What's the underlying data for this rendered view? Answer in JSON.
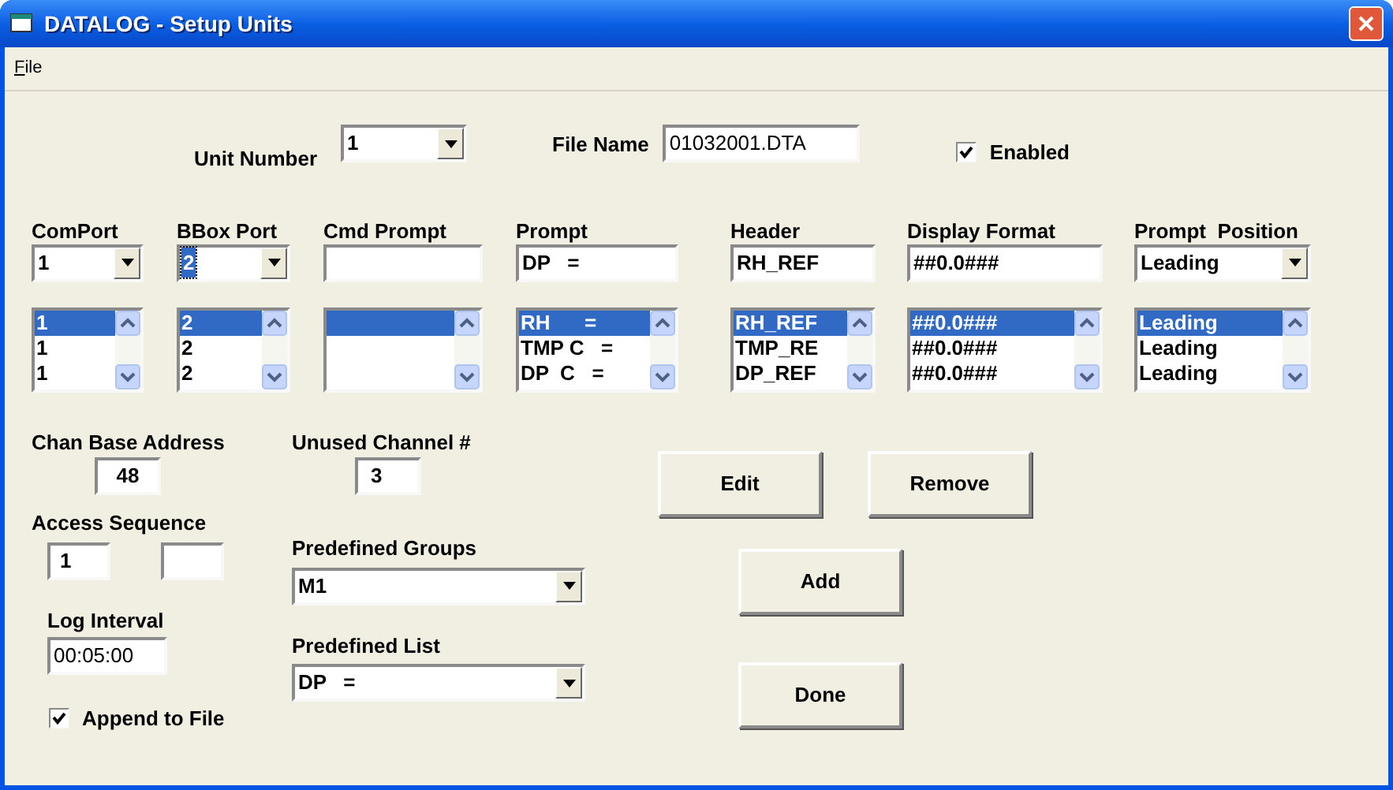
{
  "window": {
    "title": "DATALOG - Setup Units"
  },
  "menu": [
    {
      "label": "File",
      "underline_first": true
    }
  ],
  "unit_number": {
    "label": "Unit Number",
    "value": "1"
  },
  "file_name": {
    "label": "File Name",
    "value": "01032001.DTA"
  },
  "enabled": {
    "label": "Enabled",
    "checked": true
  },
  "columns": [
    {
      "label": "ComPort",
      "control": {
        "kind": "combo",
        "value": "1",
        "focused": false
      },
      "items": [
        {
          "text": "1",
          "selected": true
        },
        {
          "text": "1",
          "selected": false
        },
        {
          "text": "1",
          "selected": false
        }
      ]
    },
    {
      "label": "BBox Port",
      "control": {
        "kind": "combo",
        "value": "2",
        "focused": true
      },
      "items": [
        {
          "text": "2",
          "selected": true
        },
        {
          "text": "2",
          "selected": false
        },
        {
          "text": "2",
          "selected": false
        }
      ]
    },
    {
      "label": "Cmd Prompt",
      "control": {
        "kind": "text"
      },
      "items": [
        {
          "selected": true
        },
        {
          "selected": false
        },
        {
          "selected": false
        }
      ]
    },
    {
      "label": "Prompt",
      "control": {
        "kind": "text",
        "value": "DP   ="
      },
      "items": [
        {
          "text": "RH      =",
          "selected": true
        },
        {
          "text": "TMP C   =",
          "selected": false
        },
        {
          "text": "DP  C   =",
          "selected": false
        }
      ]
    },
    {
      "label": "Header",
      "control": {
        "kind": "text",
        "value": "RH_REF"
      },
      "items": [
        {
          "text": "RH_REF",
          "selected": true
        },
        {
          "text": "TMP_RE",
          "selected": false
        },
        {
          "text": "DP_REF",
          "selected": false
        }
      ]
    },
    {
      "label": "Display Format",
      "control": {
        "kind": "text",
        "value": "##0.0###"
      },
      "items": [
        {
          "text": "##0.0###",
          "selected": true
        },
        {
          "text": "##0.0###",
          "selected": false
        },
        {
          "text": "##0.0###",
          "selected": false
        }
      ]
    },
    {
      "label": "Prompt  Position",
      "control": {
        "kind": "combo",
        "value": "Leading",
        "focused": false
      },
      "items": [
        {
          "text": "Leading",
          "selected": true
        },
        {
          "text": "Leading",
          "selected": false
        },
        {
          "text": "Leading",
          "selected": false
        }
      ]
    }
  ],
  "chan_base_address": {
    "label": "Chan Base Address",
    "value": "48"
  },
  "unused_channel": {
    "label": "Unused Channel #",
    "value": "3"
  },
  "access_sequence": {
    "label": "Access Sequence",
    "first": "1"
  },
  "log_interval": {
    "label": "Log Interval",
    "value": "00:05:00"
  },
  "append_to_file": {
    "label": "Append to File",
    "checked": true
  },
  "predefined_groups": {
    "label": "Predefined Groups",
    "value": "M1"
  },
  "predefined_list": {
    "label": "Predefined List",
    "value": "DP   ="
  },
  "buttons": [
    {
      "label": "Edit"
    },
    {
      "label": "Remove"
    },
    {
      "label": "Add"
    },
    {
      "label": "Done"
    }
  ]
}
